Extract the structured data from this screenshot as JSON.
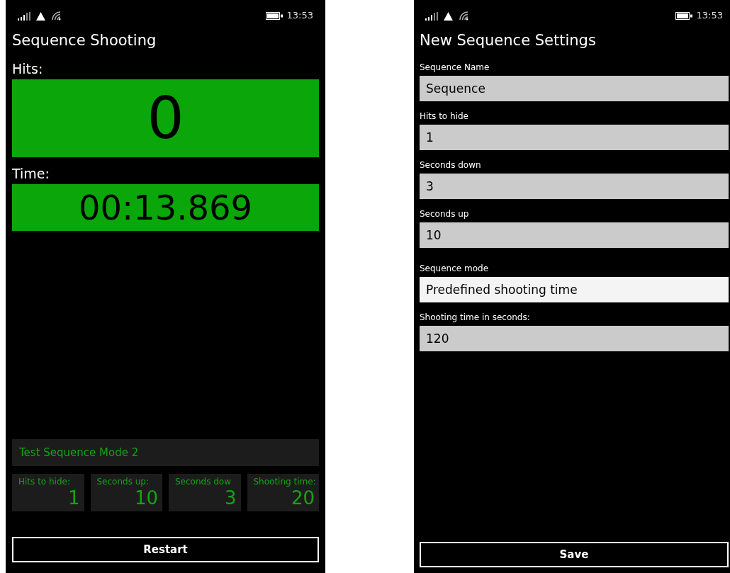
{
  "screens": [
    {
      "status_bar": {
        "time": "13:53"
      },
      "title": "Sequence Shooting",
      "hits": {
        "label": "Hits:",
        "value": "0"
      },
      "time": {
        "label": "Time:",
        "value": "00:13.869"
      },
      "sequence_name": "Test Sequence Mode 2",
      "stats": [
        {
          "label": "Hits to hide:",
          "value": "1"
        },
        {
          "label": "Seconds up:",
          "value": "10"
        },
        {
          "label": "Seconds dow",
          "value": "3"
        },
        {
          "label": "Shooting time:",
          "value": "20"
        }
      ],
      "button": "Restart"
    },
    {
      "status_bar": {
        "time": "13:53"
      },
      "title": "New Sequence Settings",
      "fields": [
        {
          "kind": "text",
          "label": "Sequence Name",
          "value": "Sequence"
        },
        {
          "kind": "text",
          "label": "Hits to hide",
          "value": "1"
        },
        {
          "kind": "text",
          "label": "Seconds down",
          "value": "3"
        },
        {
          "kind": "text",
          "label": "Seconds up",
          "value": "10"
        },
        {
          "kind": "combo",
          "label": "Sequence mode",
          "value": "Predefined shooting time"
        },
        {
          "kind": "text",
          "label": "Shooting time in seconds:",
          "value": "120"
        }
      ],
      "button": "Save"
    }
  ]
}
